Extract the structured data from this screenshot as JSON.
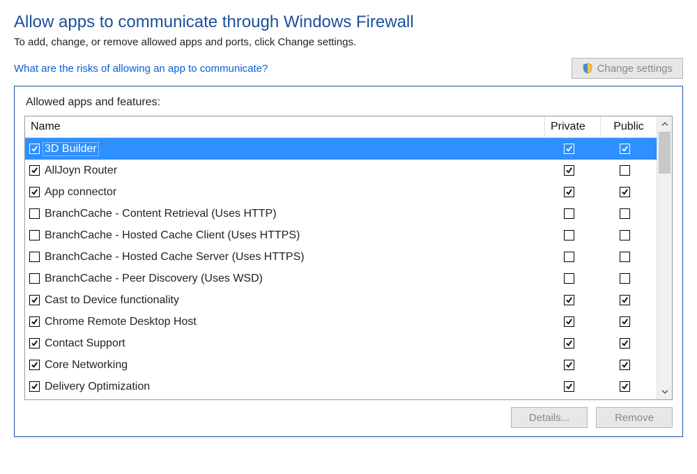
{
  "heading": "Allow apps to communicate through Windows Firewall",
  "subtext": "To add, change, or remove allowed apps and ports, click Change settings.",
  "risks_link": "What are the risks of allowing an app to communicate?",
  "change_settings_label": "Change settings",
  "panel_title": "Allowed apps and features:",
  "columns": {
    "name": "Name",
    "private": "Private",
    "public": "Public"
  },
  "buttons": {
    "details": "Details...",
    "remove": "Remove"
  },
  "rows": [
    {
      "name": "3D Builder",
      "enabled": true,
      "private": true,
      "public": true,
      "selected": true
    },
    {
      "name": "AllJoyn Router",
      "enabled": true,
      "private": true,
      "public": false,
      "selected": false
    },
    {
      "name": "App connector",
      "enabled": true,
      "private": true,
      "public": true,
      "selected": false
    },
    {
      "name": "BranchCache - Content Retrieval (Uses HTTP)",
      "enabled": false,
      "private": false,
      "public": false,
      "selected": false
    },
    {
      "name": "BranchCache - Hosted Cache Client (Uses HTTPS)",
      "enabled": false,
      "private": false,
      "public": false,
      "selected": false
    },
    {
      "name": "BranchCache - Hosted Cache Server (Uses HTTPS)",
      "enabled": false,
      "private": false,
      "public": false,
      "selected": false
    },
    {
      "name": "BranchCache - Peer Discovery (Uses WSD)",
      "enabled": false,
      "private": false,
      "public": false,
      "selected": false
    },
    {
      "name": "Cast to Device functionality",
      "enabled": true,
      "private": true,
      "public": true,
      "selected": false
    },
    {
      "name": "Chrome Remote Desktop Host",
      "enabled": true,
      "private": true,
      "public": true,
      "selected": false
    },
    {
      "name": "Contact Support",
      "enabled": true,
      "private": true,
      "public": true,
      "selected": false
    },
    {
      "name": "Core Networking",
      "enabled": true,
      "private": true,
      "public": true,
      "selected": false
    },
    {
      "name": "Delivery Optimization",
      "enabled": true,
      "private": true,
      "public": true,
      "selected": false
    }
  ]
}
